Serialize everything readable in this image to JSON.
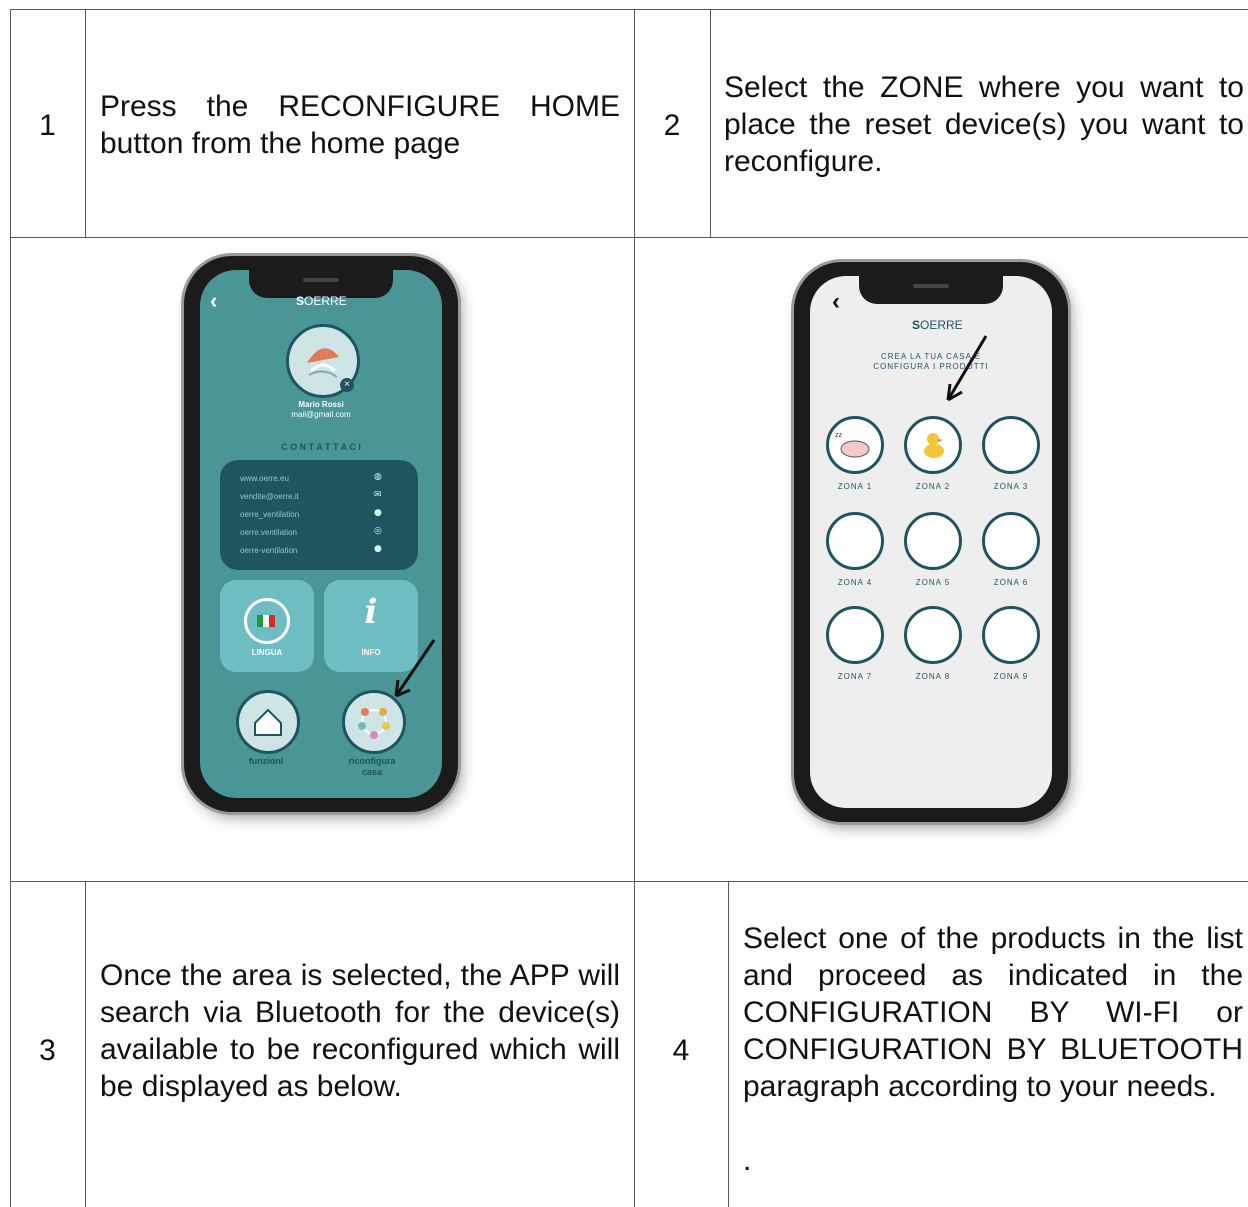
{
  "steps": [
    {
      "number": "1",
      "text": "Press the RECONFIGURE HOME button from the home page"
    },
    {
      "number": "2",
      "text": "Select the ZONE where you want to place the reset device(s) you want to reconfigure."
    },
    {
      "number": "3",
      "text": "Once the area is selected, the APP will search via Bluetooth for the device(s) available to be reconfigured which will be displayed as below."
    },
    {
      "number": "4",
      "text": "Select one of the products in the list and proceed as indicated in the CONFIGURATION BY WI-FI or CONFIGURATION BY BLUETOOTH paragraph according to your needs.",
      "trailing": "."
    }
  ],
  "phone1": {
    "brand": "OERRE",
    "user_name": "Mario Rossi",
    "user_email": "mail@gmail.com",
    "contacts_title": "C O N T A T T A C I",
    "contacts": [
      "www.oerre.eu",
      "vendite@oerre.it",
      "oerre_ventilation",
      "oerre.ventilation",
      "oerre-ventilation"
    ],
    "tile_language": "LINGUA",
    "tile_info": "INFO",
    "btn_functions": "funzioni",
    "btn_reconfigure_l1": "riconfigura",
    "btn_reconfigure_l2": "casa",
    "colors": {
      "bg": "#4a9596",
      "dark": "#1e5560",
      "tile": "#6dbdc2"
    }
  },
  "phone2": {
    "brand": "OERRE",
    "title_l1": "CREA LA TUA CASA E",
    "title_l2": "CONFIGURA I PRODOTTI",
    "zones": [
      "ZONA 1",
      "ZONA 2",
      "ZONA 3",
      "ZONA 4",
      "ZONA 5",
      "ZONA 6",
      "ZONA 7",
      "ZONA 8",
      "ZONA 9"
    ],
    "colors": {
      "bg": "#eeeeee",
      "ring": "#1e5560"
    }
  }
}
